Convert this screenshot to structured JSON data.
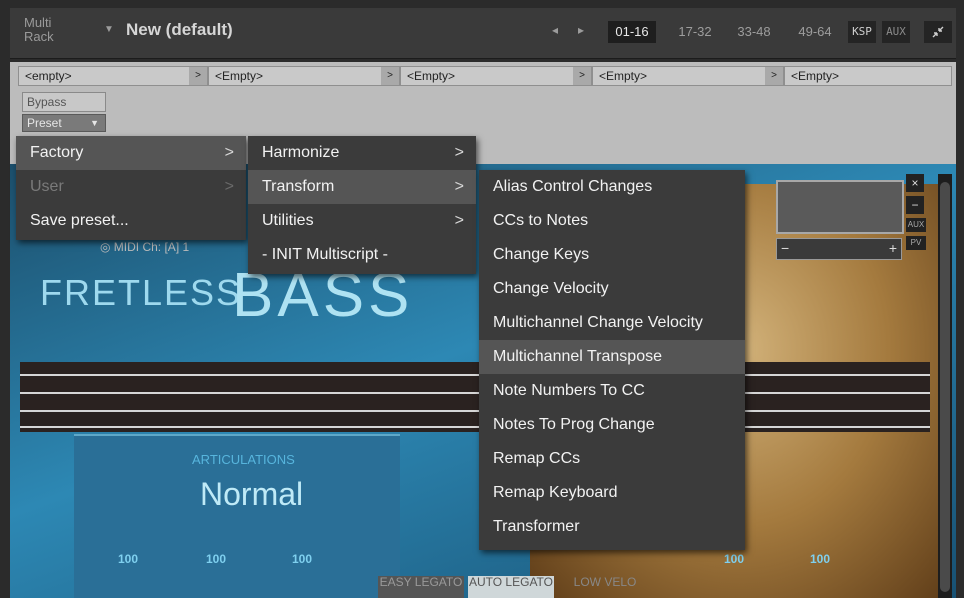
{
  "rack": {
    "label": "Multi Rack",
    "preset_name": "New (default)",
    "nav_prev": "◂",
    "nav_next": "▸",
    "ranges": [
      "01-16",
      "17-32",
      "33-48",
      "49-64"
    ],
    "ksp_label": "KSP",
    "aux_label": "AUX",
    "collapse_icon": "collapse-arrows-icon"
  },
  "script_editor": {
    "slots": [
      "<empty>",
      "<Empty>",
      "<Empty>",
      "<Empty>",
      "<Empty>"
    ],
    "bypass_label": "Bypass",
    "preset_label": "Preset"
  },
  "instrument": {
    "title_a": "FRETLESS",
    "title_b": "BASS",
    "midi_label": "◎ MIDI Ch: [A] 1",
    "articulations_title": "ARTICULATIONS",
    "articulation_value": "Normal",
    "values": [
      "100",
      "100",
      "100",
      "100",
      "100"
    ],
    "mode_easy": "EASY LEGATO",
    "mode_auto": "AUTO LEGATO",
    "mode_low": "LOW VELO",
    "vol_minus": "−",
    "vol_plus": "+",
    "close": "×",
    "minimize": "−",
    "aux_small": "AUX",
    "pv_small": "PV"
  },
  "menus": {
    "preset_menu": [
      {
        "label": "Factory",
        "submenu": true,
        "highlighted": true,
        "disabled": false
      },
      {
        "label": "User",
        "submenu": true,
        "highlighted": false,
        "disabled": true
      },
      {
        "label": "Save preset...",
        "submenu": false,
        "highlighted": false,
        "disabled": false
      }
    ],
    "factory_menu": [
      {
        "label": "Harmonize",
        "submenu": true,
        "highlighted": false
      },
      {
        "label": "Transform",
        "submenu": true,
        "highlighted": true
      },
      {
        "label": "Utilities",
        "submenu": true,
        "highlighted": false
      },
      {
        "label": "- INIT Multiscript -",
        "submenu": false,
        "highlighted": false
      }
    ],
    "transform_menu": [
      {
        "label": "Alias Control Changes",
        "highlighted": false
      },
      {
        "label": "CCs to Notes",
        "highlighted": false
      },
      {
        "label": "Change Keys",
        "highlighted": false
      },
      {
        "label": "Change Velocity",
        "highlighted": false
      },
      {
        "label": "Multichannel Change Velocity",
        "highlighted": false
      },
      {
        "label": "Multichannel Transpose",
        "highlighted": true
      },
      {
        "label": "Note Numbers To CC",
        "highlighted": false
      },
      {
        "label": "Notes To Prog Change",
        "highlighted": false
      },
      {
        "label": "Remap CCs",
        "highlighted": false
      },
      {
        "label": "Remap Keyboard",
        "highlighted": false
      },
      {
        "label": "Transformer",
        "highlighted": false
      }
    ],
    "submenu_chevron": ">"
  }
}
